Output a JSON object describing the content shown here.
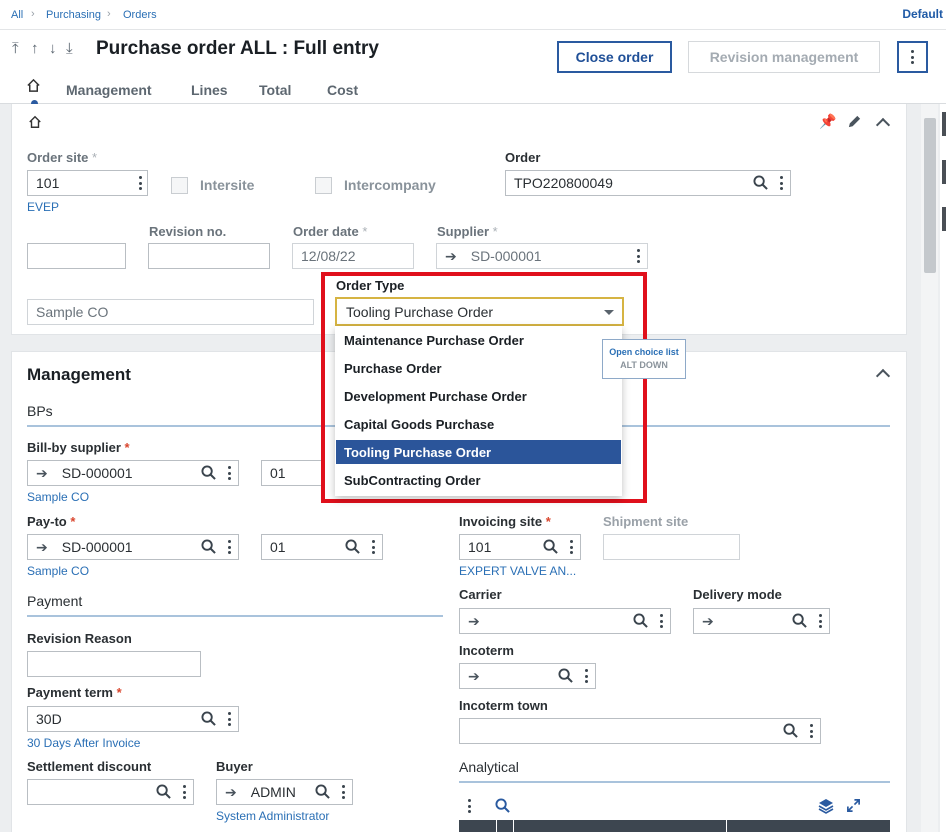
{
  "breadcrumb": [
    "All",
    "Purchasing",
    "Orders"
  ],
  "default_link": "Default",
  "header": {
    "title": "Purchase order ALL : Full entry",
    "close_order": "Close order",
    "revision_management": "Revision management",
    "tabs": [
      "Management",
      "Lines",
      "Total",
      "Cost"
    ]
  },
  "top_card": {
    "order_site_label": "Order site",
    "order_site_value": "101",
    "order_site_link": "EVEP",
    "intersite_label": "Intersite",
    "intercompany_label": "Intercompany",
    "order_label": "Order",
    "order_value": "TPO220800049",
    "revision_label": "Revision no.",
    "order_date_label": "Order date",
    "order_date_value": "12/08/22",
    "supplier_label": "Supplier",
    "supplier_value": "SD-000001",
    "supplier_name": "Sample CO"
  },
  "order_type": {
    "label": "Order Type",
    "selected": "Tooling Purchase Order",
    "options": [
      "Maintenance Purchase Order",
      "Purchase Order",
      "Development Purchase Order",
      "Capital Goods Purchase",
      "Tooling Purchase Order",
      "SubContracting Order"
    ],
    "tooltip_line1": "Open choice list",
    "tooltip_line2": "ALT DOWN"
  },
  "management": {
    "title": "Management",
    "bps_title": "BPs",
    "bill_by_label": "Bill-by supplier",
    "bill_by_value": "SD-000001",
    "bill_by_addr": "01",
    "bill_by_link": "Sample CO",
    "pay_to_label": "Pay-to",
    "pay_to_value": "SD-000001",
    "pay_to_addr": "01",
    "pay_to_link": "Sample CO",
    "invoicing_site_label": "Invoicing site",
    "invoicing_site_value": "101",
    "invoicing_site_link": "EXPERT VALVE AN...",
    "shipment_site_label": "Shipment site",
    "payment_title": "Payment",
    "revision_reason_label": "Revision Reason",
    "payment_term_label": "Payment term",
    "payment_term_value": "30D",
    "payment_term_link": "30 Days After Invoice",
    "settlement_label": "Settlement discount",
    "buyer_label": "Buyer",
    "buyer_value": "ADMIN",
    "buyer_link": "System Administrator",
    "carrier_label": "Carrier",
    "delivery_mode_label": "Delivery mode",
    "incoterm_label": "Incoterm",
    "incoterm_town_label": "Incoterm town",
    "analytical_title": "Analytical"
  },
  "colors": {
    "accent": "#2a5aa0",
    "highlight": "#e0101c",
    "selected": "#2b559a"
  }
}
